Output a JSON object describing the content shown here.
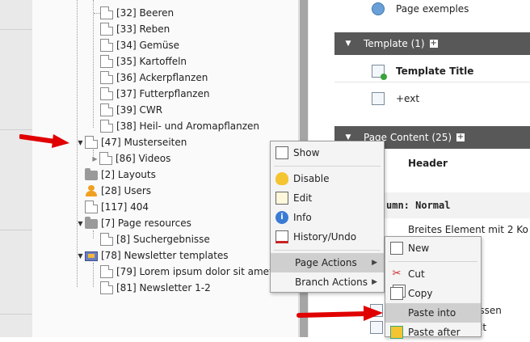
{
  "tree": {
    "items": [
      {
        "label": "[32] Beeren"
      },
      {
        "label": "[33] Reben"
      },
      {
        "label": "[34] Gemüse"
      },
      {
        "label": "[35] Kartoffeln"
      },
      {
        "label": "[36] Ackerpflanzen"
      },
      {
        "label": "[37] Futterpflanzen"
      },
      {
        "label": "[39] CWR"
      },
      {
        "label": "[38] Heil- und Aromapflanzen"
      },
      {
        "label": "[47] Musterseiten"
      },
      {
        "label": "[86] Videos"
      },
      {
        "label": "[2] Layouts"
      },
      {
        "label": "[28] Users"
      },
      {
        "label": "[117] 404"
      },
      {
        "label": "[7] Page resources"
      },
      {
        "label": "[8] Suchergebnisse"
      },
      {
        "label": "[78] Newsletter templates"
      },
      {
        "label": "[79] Lorem ipsum dolor sit amet"
      },
      {
        "label": "[81] Newsletter 1-2"
      }
    ]
  },
  "right": {
    "page_exemples": "Page exemples",
    "template_header": "Template (1)",
    "template_title": "Template Title",
    "ext_label": "+ext",
    "page_content_header": "Page Content (25)",
    "header_label": "Header",
    "column_label": "umn: Normal",
    "breites": "Breites Element mit 2 Ko",
    "rossen": "össen",
    "lt": "lt"
  },
  "context_menu": {
    "items": [
      {
        "label": "Show",
        "icon": "show-icon"
      },
      {
        "label": "Disable",
        "icon": "lightbulb-icon"
      },
      {
        "label": "Edit",
        "icon": "pencil-icon"
      },
      {
        "label": "Info",
        "icon": "info-icon"
      },
      {
        "label": "History/Undo",
        "icon": "history-icon"
      },
      {
        "label": "Page Actions",
        "icon": ""
      },
      {
        "label": "Branch Actions",
        "icon": ""
      }
    ]
  },
  "submenu": {
    "items": [
      {
        "label": "New",
        "icon": "new-page-icon"
      },
      {
        "label": "Cut",
        "icon": "scissors-icon"
      },
      {
        "label": "Copy",
        "icon": "copy-icon"
      },
      {
        "label": "Paste into",
        "icon": "paste-into-icon"
      },
      {
        "label": "Paste after",
        "icon": "paste-after-icon"
      }
    ]
  },
  "colors": {
    "header_bar": "#585858",
    "highlight": "#cfcfcf",
    "arrow": "#e00000"
  }
}
